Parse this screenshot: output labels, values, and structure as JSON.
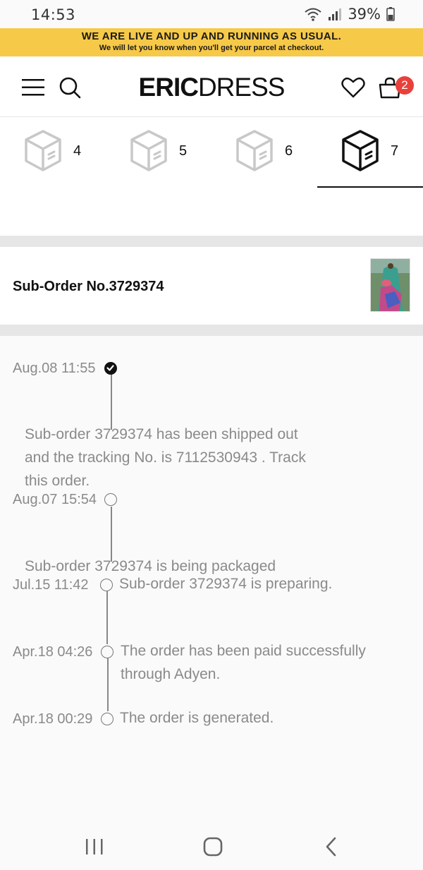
{
  "status_bar": {
    "time": "14:53",
    "battery": "39%",
    "icons": [
      "wifi-icon",
      "signal-icon",
      "battery-icon"
    ]
  },
  "banner": {
    "line1": "WE ARE LIVE AND UP AND RUNNING AS USUAL.",
    "line2": "We will let you know when you'll get your parcel at checkout.",
    "color": "#f7c948"
  },
  "header": {
    "logo_bold": "ERIC",
    "logo_regular": "DRESS",
    "icons": [
      "menu-icon",
      "search-icon",
      "heart-icon",
      "bag-icon"
    ],
    "cart_count": "2",
    "badge_color": "#e8413c"
  },
  "package_tabs": [
    {
      "label": "4",
      "active": false
    },
    {
      "label": "5",
      "active": false
    },
    {
      "label": "6",
      "active": false
    },
    {
      "label": "7",
      "active": true
    }
  ],
  "suborder": {
    "title": "Sub-Order No.3729374"
  },
  "timeline": [
    {
      "date": "Aug.08 11:55",
      "done": true,
      "lines": [
        "Sub-order 3729374 has been shipped out",
        "and the tracking No. is 7112530943 . Track",
        "this order."
      ]
    },
    {
      "date": "Aug.07 15:54",
      "done": false,
      "lines": [
        "Sub-order 3729374 is being packaged"
      ]
    },
    {
      "date": "Jul.15 11:42",
      "done": false,
      "lines": [
        "Sub-order 3729374 is preparing."
      ]
    },
    {
      "date": "Apr.18 04:26",
      "done": false,
      "lines": [
        "The order has been paid successfully",
        "through Adyen."
      ]
    },
    {
      "date": "Apr.18 00:29",
      "done": false,
      "lines": [
        "The order is generated."
      ]
    }
  ],
  "nav_bar": {
    "icons": [
      "recent-apps-icon",
      "home-icon",
      "back-icon"
    ]
  }
}
